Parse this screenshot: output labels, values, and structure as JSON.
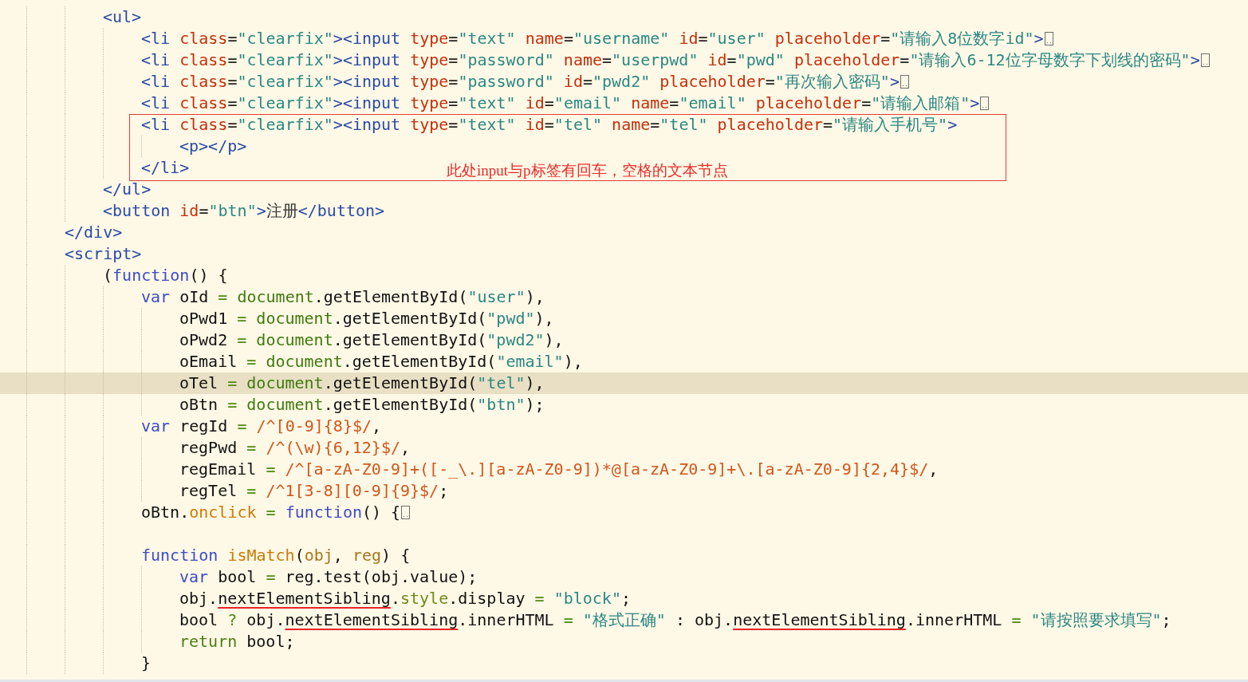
{
  "lines": [
    {
      "kind": "group",
      "children": [
        {
          "kind": "code",
          "current": false,
          "folded": false,
          "tokens": [
            {
              "kind": "tag",
              "text": "<ul>"
            }
          ],
          "children": [
            {
              "kind": "code",
              "current": false,
              "folded": true,
              "tokens": [
                {
                  "kind": "tag",
                  "text": "<li "
                },
                {
                  "kind": "attr",
                  "text": "class"
                },
                {
                  "kind": "punct",
                  "text": "="
                },
                {
                  "kind": "value",
                  "text": "\"clearfix\""
                },
                {
                  "kind": "tag",
                  "text": "><input "
                },
                {
                  "kind": "attr",
                  "text": "type"
                },
                {
                  "kind": "punct",
                  "text": "="
                },
                {
                  "kind": "value",
                  "text": "\"text\" "
                },
                {
                  "kind": "attr",
                  "text": "name"
                },
                {
                  "kind": "punct",
                  "text": "="
                },
                {
                  "kind": "value",
                  "text": "\"username\" "
                },
                {
                  "kind": "attr",
                  "text": "id"
                },
                {
                  "kind": "punct",
                  "text": "="
                },
                {
                  "kind": "value",
                  "text": "\"user\" "
                },
                {
                  "kind": "attr",
                  "text": "placeholder"
                },
                {
                  "kind": "punct",
                  "text": "="
                },
                {
                  "kind": "value",
                  "text": "\"请输入8位数字id\""
                },
                {
                  "kind": "tag",
                  "text": ">"
                }
              ]
            },
            {
              "kind": "code",
              "current": false,
              "folded": true,
              "tokens": [
                {
                  "kind": "tag",
                  "text": "<li "
                },
                {
                  "kind": "attr",
                  "text": "class"
                },
                {
                  "kind": "punct",
                  "text": "="
                },
                {
                  "kind": "value",
                  "text": "\"clearfix\""
                },
                {
                  "kind": "tag",
                  "text": "><input "
                },
                {
                  "kind": "attr",
                  "text": "type"
                },
                {
                  "kind": "punct",
                  "text": "="
                },
                {
                  "kind": "value",
                  "text": "\"password\" "
                },
                {
                  "kind": "attr",
                  "text": "name"
                },
                {
                  "kind": "punct",
                  "text": "="
                },
                {
                  "kind": "value",
                  "text": "\"userpwd\" "
                },
                {
                  "kind": "attr",
                  "text": "id"
                },
                {
                  "kind": "punct",
                  "text": "="
                },
                {
                  "kind": "value",
                  "text": "\"pwd\" "
                },
                {
                  "kind": "attr",
                  "text": "placeholder"
                },
                {
                  "kind": "punct",
                  "text": "="
                },
                {
                  "kind": "value",
                  "text": "\"请输入6-12位字母数字下划线的密码\""
                },
                {
                  "kind": "tag",
                  "text": ">"
                }
              ]
            },
            {
              "kind": "code",
              "current": false,
              "folded": true,
              "tokens": [
                {
                  "kind": "tag",
                  "text": "<li "
                },
                {
                  "kind": "attr",
                  "text": "class"
                },
                {
                  "kind": "punct",
                  "text": "="
                },
                {
                  "kind": "value",
                  "text": "\"clearfix\""
                },
                {
                  "kind": "tag",
                  "text": "><input "
                },
                {
                  "kind": "attr",
                  "text": "type"
                },
                {
                  "kind": "punct",
                  "text": "="
                },
                {
                  "kind": "value",
                  "text": "\"password\" "
                },
                {
                  "kind": "attr",
                  "text": "id"
                },
                {
                  "kind": "punct",
                  "text": "="
                },
                {
                  "kind": "value",
                  "text": "\"pwd2\" "
                },
                {
                  "kind": "attr",
                  "text": "placeholder"
                },
                {
                  "kind": "punct",
                  "text": "="
                },
                {
                  "kind": "value",
                  "text": "\"再次输入密码\""
                },
                {
                  "kind": "tag",
                  "text": ">"
                }
              ]
            },
            {
              "kind": "code",
              "current": false,
              "folded": true,
              "tokens": [
                {
                  "kind": "tag",
                  "text": "<li "
                },
                {
                  "kind": "attr",
                  "text": "class"
                },
                {
                  "kind": "punct",
                  "text": "="
                },
                {
                  "kind": "value",
                  "text": "\"clearfix\""
                },
                {
                  "kind": "tag",
                  "text": "><input "
                },
                {
                  "kind": "attr",
                  "text": "type"
                },
                {
                  "kind": "punct",
                  "text": "="
                },
                {
                  "kind": "value",
                  "text": "\"text\" "
                },
                {
                  "kind": "attr",
                  "text": "id"
                },
                {
                  "kind": "punct",
                  "text": "="
                },
                {
                  "kind": "value",
                  "text": "\"email\" "
                },
                {
                  "kind": "attr",
                  "text": "name"
                },
                {
                  "kind": "punct",
                  "text": "="
                },
                {
                  "kind": "value",
                  "text": "\"email\" "
                },
                {
                  "kind": "attr",
                  "text": "placeholder"
                },
                {
                  "kind": "punct",
                  "text": "="
                },
                {
                  "kind": "value",
                  "text": "\"请输入邮箱\""
                },
                {
                  "kind": "tag",
                  "text": ">"
                }
              ]
            },
            {
              "kind": "code",
              "current": false,
              "folded": false,
              "tokens": [
                {
                  "kind": "tag",
                  "text": "<li "
                },
                {
                  "kind": "attr",
                  "text": "class"
                },
                {
                  "kind": "punct",
                  "text": "="
                },
                {
                  "kind": "value",
                  "text": "\"clearfix\""
                },
                {
                  "kind": "tag",
                  "text": "><input "
                },
                {
                  "kind": "attr",
                  "text": "type"
                },
                {
                  "kind": "punct",
                  "text": "="
                },
                {
                  "kind": "value",
                  "text": "\"text\" "
                },
                {
                  "kind": "attr",
                  "text": "id"
                },
                {
                  "kind": "punct",
                  "text": "="
                },
                {
                  "kind": "value",
                  "text": "\"tel\" "
                },
                {
                  "kind": "attr",
                  "text": "name"
                },
                {
                  "kind": "punct",
                  "text": "="
                },
                {
                  "kind": "value",
                  "text": "\"tel\" "
                },
                {
                  "kind": "attr",
                  "text": "placeholder"
                },
                {
                  "kind": "punct",
                  "text": "="
                },
                {
                  "kind": "value",
                  "text": "\"请输入手机号\""
                },
                {
                  "kind": "tag",
                  "text": ">"
                }
              ],
              "children": [
                {
                  "kind": "code",
                  "current": false,
                  "folded": false,
                  "tokens": [
                    {
                      "kind": "tag",
                      "text": "<p></p>"
                    }
                  ]
                }
              ]
            },
            {
              "kind": "code",
              "current": false,
              "folded": false,
              "tokens": [
                {
                  "kind": "tag",
                  "text": "</li>"
                }
              ]
            }
          ]
        },
        {
          "kind": "code",
          "current": false,
          "folded": false,
          "tokens": [
            {
              "kind": "tag",
              "text": "</ul>"
            }
          ]
        },
        {
          "kind": "code",
          "current": false,
          "folded": false,
          "tokens": [
            {
              "kind": "tag",
              "text": "<button "
            },
            {
              "kind": "attr",
              "text": "id"
            },
            {
              "kind": "punct",
              "text": "="
            },
            {
              "kind": "value",
              "text": "\"btn\""
            },
            {
              "kind": "tag",
              "text": ">"
            },
            {
              "kind": "text",
              "text": "注册"
            },
            {
              "kind": "tag",
              "text": "</button>"
            }
          ]
        }
      ]
    },
    {
      "kind": "code",
      "current": false,
      "folded": false,
      "tokens": [
        {
          "kind": "tag",
          "text": "</div>"
        }
      ]
    },
    {
      "kind": "code",
      "current": false,
      "folded": false,
      "tokens": [
        {
          "kind": "tag",
          "text": "<script>"
        }
      ],
      "children": [
        {
          "kind": "code",
          "current": false,
          "folded": false,
          "tokens": [
            {
              "kind": "plain",
              "text": "("
            },
            {
              "kind": "kw",
              "text": "function"
            },
            {
              "kind": "plain",
              "text": "() {"
            }
          ],
          "children": [
            {
              "kind": "code",
              "current": false,
              "folded": false,
              "tokens": [
                {
                  "kind": "kw",
                  "text": "var"
                },
                {
                  "kind": "plain",
                  "text": " oId "
                },
                {
                  "kind": "op",
                  "text": "= "
                },
                {
                  "kind": "obj",
                  "text": "document"
                },
                {
                  "kind": "plain",
                  "text": ".getElementById("
                },
                {
                  "kind": "str",
                  "text": "\"user\""
                },
                {
                  "kind": "plain",
                  "text": "),"
                }
              ],
              "children": [
                {
                  "kind": "code",
                  "current": false,
                  "folded": false,
                  "tokens": [
                    {
                      "kind": "plain",
                      "text": "oPwd1 "
                    },
                    {
                      "kind": "op",
                      "text": "= "
                    },
                    {
                      "kind": "obj",
                      "text": "document"
                    },
                    {
                      "kind": "plain",
                      "text": ".getElementById("
                    },
                    {
                      "kind": "str",
                      "text": "\"pwd\""
                    },
                    {
                      "kind": "plain",
                      "text": "),"
                    }
                  ]
                },
                {
                  "kind": "code",
                  "current": false,
                  "folded": false,
                  "tokens": [
                    {
                      "kind": "plain",
                      "text": "oPwd2 "
                    },
                    {
                      "kind": "op",
                      "text": "= "
                    },
                    {
                      "kind": "obj",
                      "text": "document"
                    },
                    {
                      "kind": "plain",
                      "text": ".getElementById("
                    },
                    {
                      "kind": "str",
                      "text": "\"pwd2\""
                    },
                    {
                      "kind": "plain",
                      "text": "),"
                    }
                  ]
                },
                {
                  "kind": "code",
                  "current": false,
                  "folded": false,
                  "tokens": [
                    {
                      "kind": "plain",
                      "text": "oEmail "
                    },
                    {
                      "kind": "op",
                      "text": "= "
                    },
                    {
                      "kind": "obj",
                      "text": "document"
                    },
                    {
                      "kind": "plain",
                      "text": ".getElementById("
                    },
                    {
                      "kind": "str",
                      "text": "\"email\""
                    },
                    {
                      "kind": "plain",
                      "text": "),"
                    }
                  ]
                },
                {
                  "kind": "code",
                  "current": true,
                  "folded": false,
                  "tokens": [
                    {
                      "kind": "plain",
                      "text": "oTel "
                    },
                    {
                      "kind": "op",
                      "text": "= "
                    },
                    {
                      "kind": "obj",
                      "text": "document"
                    },
                    {
                      "kind": "plain",
                      "text": ".getElementById("
                    },
                    {
                      "kind": "str",
                      "text": "\"tel\""
                    },
                    {
                      "kind": "plain",
                      "text": "),"
                    }
                  ]
                },
                {
                  "kind": "code",
                  "current": false,
                  "folded": false,
                  "tokens": [
                    {
                      "kind": "plain",
                      "text": "oBtn "
                    },
                    {
                      "kind": "op",
                      "text": "= "
                    },
                    {
                      "kind": "obj",
                      "text": "document"
                    },
                    {
                      "kind": "plain",
                      "text": ".getElementById("
                    },
                    {
                      "kind": "str",
                      "text": "\"btn\""
                    },
                    {
                      "kind": "plain",
                      "text": ");"
                    }
                  ]
                }
              ]
            },
            {
              "kind": "code",
              "current": false,
              "folded": false,
              "tokens": [
                {
                  "kind": "kw",
                  "text": "var"
                },
                {
                  "kind": "plain",
                  "text": " regId "
                },
                {
                  "kind": "op",
                  "text": "= "
                },
                {
                  "kind": "regex",
                  "text": "/^[0-9]{8}$/"
                },
                {
                  "kind": "plain",
                  "text": ","
                }
              ],
              "children": [
                {
                  "kind": "code",
                  "current": false,
                  "folded": false,
                  "tokens": [
                    {
                      "kind": "plain",
                      "text": "regPwd "
                    },
                    {
                      "kind": "op",
                      "text": "= "
                    },
                    {
                      "kind": "regex",
                      "text": "/^(\\w){6,12}$/"
                    },
                    {
                      "kind": "plain",
                      "text": ","
                    }
                  ]
                },
                {
                  "kind": "code",
                  "current": false,
                  "folded": false,
                  "tokens": [
                    {
                      "kind": "plain",
                      "text": "regEmail "
                    },
                    {
                      "kind": "op",
                      "text": "= "
                    },
                    {
                      "kind": "regex",
                      "text": "/^[a-zA-Z0-9]+([-_\\.][a-zA-Z0-9])*@[a-zA-Z0-9]+\\.[a-zA-Z0-9]{2,4}$/"
                    },
                    {
                      "kind": "plain",
                      "text": ","
                    }
                  ]
                },
                {
                  "kind": "code",
                  "current": false,
                  "folded": false,
                  "tokens": [
                    {
                      "kind": "plain",
                      "text": "regTel "
                    },
                    {
                      "kind": "op",
                      "text": "= "
                    },
                    {
                      "kind": "regex",
                      "text": "/^1[3-8][0-9]{9}$/"
                    },
                    {
                      "kind": "plain",
                      "text": ";"
                    }
                  ]
                }
              ]
            },
            {
              "kind": "code",
              "current": false,
              "folded": true,
              "tokens": [
                {
                  "kind": "plain",
                  "text": "oBtn."
                },
                {
                  "kind": "prop",
                  "text": "onclick"
                },
                {
                  "kind": "op",
                  "text": " = "
                },
                {
                  "kind": "kw",
                  "text": "function"
                },
                {
                  "kind": "plain",
                  "text": "() {"
                }
              ]
            },
            {
              "kind": "blank"
            },
            {
              "kind": "code",
              "current": false,
              "folded": false,
              "tokens": [
                {
                  "kind": "kw",
                  "text": "function "
                },
                {
                  "kind": "fn",
                  "text": "isMatch"
                },
                {
                  "kind": "plain",
                  "text": "("
                },
                {
                  "kind": "param",
                  "text": "obj"
                },
                {
                  "kind": "plain",
                  "text": ", "
                },
                {
                  "kind": "param",
                  "text": "reg"
                },
                {
                  "kind": "plain",
                  "text": ") {"
                }
              ],
              "children": [
                {
                  "kind": "code",
                  "current": false,
                  "folded": false,
                  "tokens": [
                    {
                      "kind": "kw",
                      "text": "var"
                    },
                    {
                      "kind": "plain",
                      "text": " bool "
                    },
                    {
                      "kind": "op",
                      "text": "= "
                    },
                    {
                      "kind": "plain",
                      "text": "reg.test(obj.value);"
                    }
                  ]
                },
                {
                  "kind": "code",
                  "current": false,
                  "folded": false,
                  "tokens": [
                    {
                      "kind": "plain",
                      "text": "obj."
                    },
                    {
                      "kind": "marked",
                      "text": "nextElementSibling"
                    },
                    {
                      "kind": "plain",
                      "text": "."
                    },
                    {
                      "kind": "member",
                      "text": "style"
                    },
                    {
                      "kind": "plain",
                      "text": ".display "
                    },
                    {
                      "kind": "op",
                      "text": "= "
                    },
                    {
                      "kind": "str",
                      "text": "\"block\""
                    },
                    {
                      "kind": "plain",
                      "text": ";"
                    }
                  ]
                },
                {
                  "kind": "code",
                  "current": false,
                  "folded": false,
                  "tokens": [
                    {
                      "kind": "plain",
                      "text": "bool "
                    },
                    {
                      "kind": "op",
                      "text": "? "
                    },
                    {
                      "kind": "plain",
                      "text": "obj."
                    },
                    {
                      "kind": "marked",
                      "text": "nextElementSibling"
                    },
                    {
                      "kind": "plain",
                      "text": ".innerHTML "
                    },
                    {
                      "kind": "op",
                      "text": "= "
                    },
                    {
                      "kind": "str",
                      "text": "\"格式正确\""
                    },
                    {
                      "kind": "plain",
                      "text": " : obj."
                    },
                    {
                      "kind": "marked",
                      "text": "nextElementSibling"
                    },
                    {
                      "kind": "plain",
                      "text": ".innerHTML "
                    },
                    {
                      "kind": "op",
                      "text": "= "
                    },
                    {
                      "kind": "str",
                      "text": "\"请按照要求填写\""
                    },
                    {
                      "kind": "plain",
                      "text": ";"
                    }
                  ]
                },
                {
                  "kind": "code",
                  "current": false,
                  "folded": false,
                  "tokens": [
                    {
                      "kind": "ret",
                      "text": "return"
                    },
                    {
                      "kind": "plain",
                      "text": " bool;"
                    }
                  ]
                }
              ]
            },
            {
              "kind": "code",
              "current": false,
              "folded": false,
              "tokens": [
                {
                  "kind": "plain",
                  "text": "}"
                }
              ]
            }
          ]
        }
      ]
    }
  ],
  "annotation": {
    "text": "此处input与p标签有回车，空格的文本节点"
  }
}
